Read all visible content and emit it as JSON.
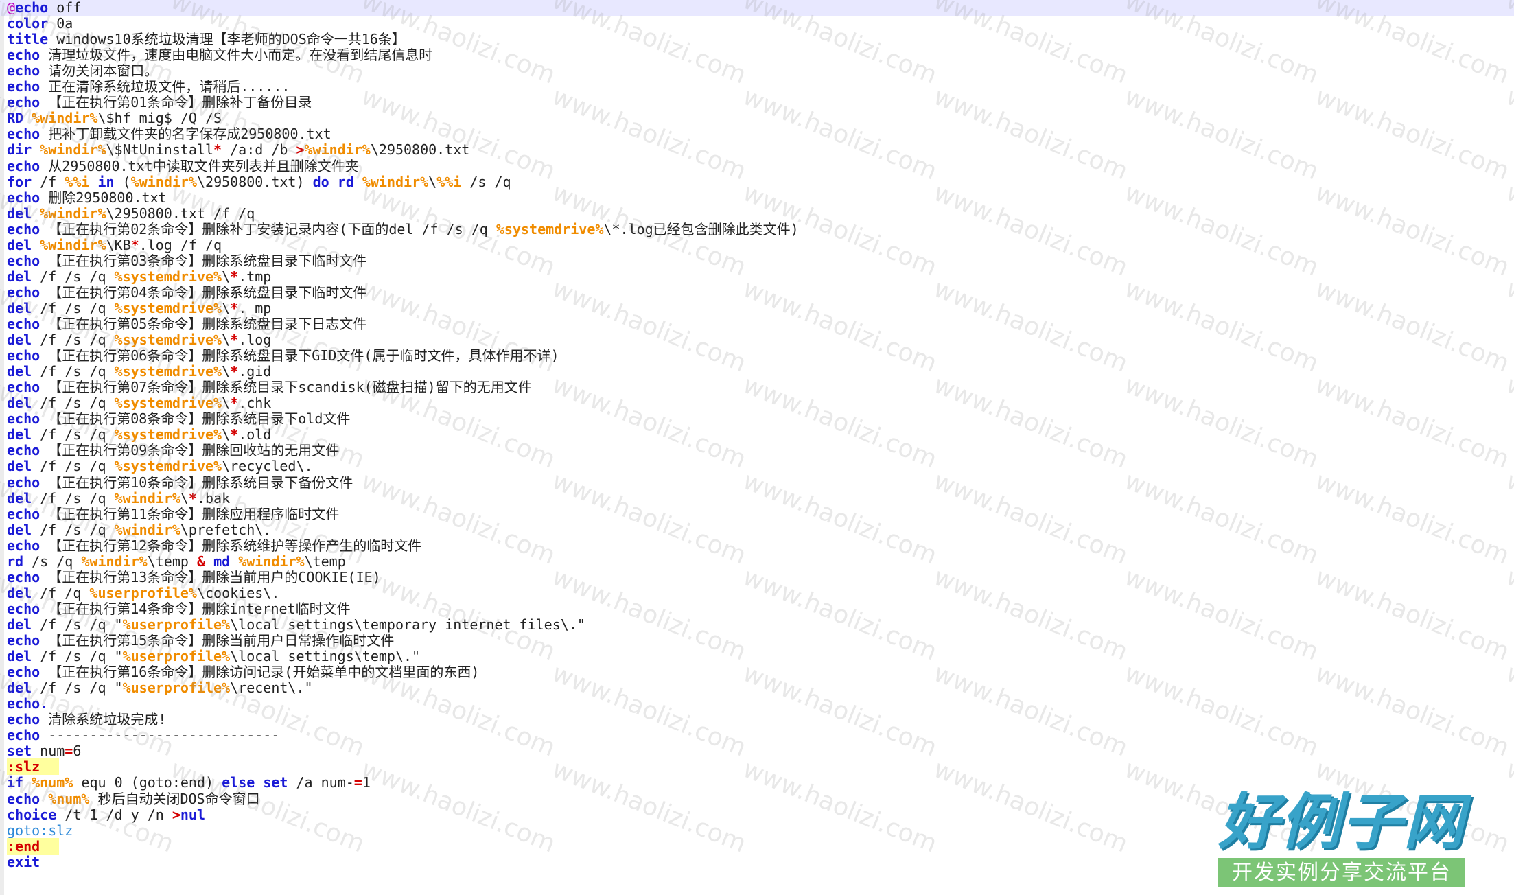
{
  "editor": {
    "lines": [
      [
        [
          "at",
          "@"
        ],
        [
          "kw",
          "echo"
        ],
        [
          "tx",
          " off"
        ]
      ],
      [
        [
          "kw",
          "color"
        ],
        [
          "tx",
          " 0a"
        ]
      ],
      [
        [
          "kw",
          "title"
        ],
        [
          "tx",
          " windows10系统垃圾清理【李老师的DOS命令一共16条】"
        ]
      ],
      [
        [
          "kw",
          "echo"
        ],
        [
          "tx",
          " 清理垃圾文件，速度由电脑文件大小而定。在没看到结尾信息时"
        ]
      ],
      [
        [
          "kw",
          "echo"
        ],
        [
          "tx",
          " 请勿关闭本窗口。"
        ]
      ],
      [
        [
          "kw",
          "echo"
        ],
        [
          "tx",
          " 正在清除系统垃圾文件，请稍后......"
        ]
      ],
      [
        [
          "kw",
          "echo"
        ],
        [
          "tx",
          " 【正在执行第01条命令】删除补丁备份目录"
        ]
      ],
      [
        [
          "kw",
          "RD"
        ],
        [
          "tx",
          " "
        ],
        [
          "var",
          "%windir%"
        ],
        [
          "tx",
          "\\$hf_mig$ /Q /S"
        ]
      ],
      [
        [
          "kw",
          "echo"
        ],
        [
          "tx",
          " 把补丁卸载文件夹的名字保存成2950800.txt"
        ]
      ],
      [
        [
          "kw",
          "dir"
        ],
        [
          "tx",
          " "
        ],
        [
          "var",
          "%windir%"
        ],
        [
          "tx",
          "\\$NtUninstall"
        ],
        [
          "op",
          "*"
        ],
        [
          "tx",
          " /a:d /b "
        ],
        [
          "op",
          ">"
        ],
        [
          "var",
          "%windir%"
        ],
        [
          "tx",
          "\\2950800.txt"
        ]
      ],
      [
        [
          "kw",
          "echo"
        ],
        [
          "tx",
          " 从2950800.txt中读取文件夹列表并且删除文件夹"
        ]
      ],
      [
        [
          "kw",
          "for"
        ],
        [
          "tx",
          " /f "
        ],
        [
          "var",
          "%%i"
        ],
        [
          "tx",
          " "
        ],
        [
          "kw",
          "in"
        ],
        [
          "tx",
          " ("
        ],
        [
          "var",
          "%windir%"
        ],
        [
          "tx",
          "\\2950800.txt) "
        ],
        [
          "kw",
          "do"
        ],
        [
          "tx",
          " "
        ],
        [
          "kw",
          "rd"
        ],
        [
          "tx",
          " "
        ],
        [
          "var",
          "%windir%"
        ],
        [
          "tx",
          "\\"
        ],
        [
          "var",
          "%%i"
        ],
        [
          "tx",
          " /s /q"
        ]
      ],
      [
        [
          "kw",
          "echo"
        ],
        [
          "tx",
          " 删除2950800.txt"
        ]
      ],
      [
        [
          "kw",
          "del"
        ],
        [
          "tx",
          " "
        ],
        [
          "var",
          "%windir%"
        ],
        [
          "tx",
          "\\2950800.txt /f /q"
        ]
      ],
      [
        [
          "kw",
          "echo"
        ],
        [
          "tx",
          " 【正在执行第02条命令】删除补丁安装记录内容(下面的del /f /s /q "
        ],
        [
          "var",
          "%systemdrive%"
        ],
        [
          "tx",
          "\\*.log已经包含删除此类文件)"
        ]
      ],
      [
        [
          "kw",
          "del"
        ],
        [
          "tx",
          " "
        ],
        [
          "var",
          "%windir%"
        ],
        [
          "tx",
          "\\KB"
        ],
        [
          "op",
          "*"
        ],
        [
          "tx",
          ".log /f /q"
        ]
      ],
      [
        [
          "kw",
          "echo"
        ],
        [
          "tx",
          " 【正在执行第03条命令】删除系统盘目录下临时文件"
        ]
      ],
      [
        [
          "kw",
          "del"
        ],
        [
          "tx",
          " /f /s /q "
        ],
        [
          "var",
          "%systemdrive%"
        ],
        [
          "tx",
          "\\"
        ],
        [
          "op",
          "*"
        ],
        [
          "tx",
          ".tmp"
        ]
      ],
      [
        [
          "kw",
          "echo"
        ],
        [
          "tx",
          " 【正在执行第04条命令】删除系统盘目录下临时文件"
        ]
      ],
      [
        [
          "kw",
          "del"
        ],
        [
          "tx",
          " /f /s /q "
        ],
        [
          "var",
          "%systemdrive%"
        ],
        [
          "tx",
          "\\"
        ],
        [
          "op",
          "*"
        ],
        [
          "tx",
          "._mp"
        ]
      ],
      [
        [
          "kw",
          "echo"
        ],
        [
          "tx",
          " 【正在执行第05条命令】删除系统盘目录下日志文件"
        ]
      ],
      [
        [
          "kw",
          "del"
        ],
        [
          "tx",
          " /f /s /q "
        ],
        [
          "var",
          "%systemdrive%"
        ],
        [
          "tx",
          "\\"
        ],
        [
          "op",
          "*"
        ],
        [
          "tx",
          ".log"
        ]
      ],
      [
        [
          "kw",
          "echo"
        ],
        [
          "tx",
          " 【正在执行第06条命令】删除系统盘目录下GID文件(属于临时文件，具体作用不详)"
        ]
      ],
      [
        [
          "kw",
          "del"
        ],
        [
          "tx",
          " /f /s /q "
        ],
        [
          "var",
          "%systemdrive%"
        ],
        [
          "tx",
          "\\"
        ],
        [
          "op",
          "*"
        ],
        [
          "tx",
          ".gid"
        ]
      ],
      [
        [
          "kw",
          "echo"
        ],
        [
          "tx",
          " 【正在执行第07条命令】删除系统目录下scandisk(磁盘扫描)留下的无用文件"
        ]
      ],
      [
        [
          "kw",
          "del"
        ],
        [
          "tx",
          " /f /s /q "
        ],
        [
          "var",
          "%systemdrive%"
        ],
        [
          "tx",
          "\\"
        ],
        [
          "op",
          "*"
        ],
        [
          "tx",
          ".chk"
        ]
      ],
      [
        [
          "kw",
          "echo"
        ],
        [
          "tx",
          " 【正在执行第08条命令】删除系统目录下old文件"
        ]
      ],
      [
        [
          "kw",
          "del"
        ],
        [
          "tx",
          " /f /s /q "
        ],
        [
          "var",
          "%systemdrive%"
        ],
        [
          "tx",
          "\\"
        ],
        [
          "op",
          "*"
        ],
        [
          "tx",
          ".old"
        ]
      ],
      [
        [
          "kw",
          "echo"
        ],
        [
          "tx",
          " 【正在执行第09条命令】删除回收站的无用文件"
        ]
      ],
      [
        [
          "kw",
          "del"
        ],
        [
          "tx",
          " /f /s /q "
        ],
        [
          "var",
          "%systemdrive%"
        ],
        [
          "tx",
          "\\recycled\\."
        ]
      ],
      [
        [
          "kw",
          "echo"
        ],
        [
          "tx",
          " 【正在执行第10条命令】删除系统目录下备份文件"
        ]
      ],
      [
        [
          "kw",
          "del"
        ],
        [
          "tx",
          " /f /s /q "
        ],
        [
          "var",
          "%windir%"
        ],
        [
          "tx",
          "\\"
        ],
        [
          "op",
          "*"
        ],
        [
          "tx",
          ".bak"
        ]
      ],
      [
        [
          "kw",
          "echo"
        ],
        [
          "tx",
          " 【正在执行第11条命令】删除应用程序临时文件"
        ]
      ],
      [
        [
          "kw",
          "del"
        ],
        [
          "tx",
          " /f /s /q "
        ],
        [
          "var",
          "%windir%"
        ],
        [
          "tx",
          "\\prefetch\\."
        ]
      ],
      [
        [
          "kw",
          "echo"
        ],
        [
          "tx",
          " 【正在执行第12条命令】删除系统维护等操作产生的临时文件"
        ]
      ],
      [
        [
          "kw",
          "rd"
        ],
        [
          "tx",
          " /s /q "
        ],
        [
          "var",
          "%windir%"
        ],
        [
          "tx",
          "\\temp "
        ],
        [
          "op",
          "&"
        ],
        [
          "tx",
          " "
        ],
        [
          "kw",
          "md"
        ],
        [
          "tx",
          " "
        ],
        [
          "var",
          "%windir%"
        ],
        [
          "tx",
          "\\temp"
        ]
      ],
      [
        [
          "kw",
          "echo"
        ],
        [
          "tx",
          " 【正在执行第13条命令】删除当前用户的COOKIE(IE)"
        ]
      ],
      [
        [
          "kw",
          "del"
        ],
        [
          "tx",
          " /f /q "
        ],
        [
          "var",
          "%userprofile%"
        ],
        [
          "tx",
          "\\cookies\\."
        ]
      ],
      [
        [
          "kw",
          "echo"
        ],
        [
          "tx",
          " 【正在执行第14条命令】删除internet临时文件"
        ]
      ],
      [
        [
          "kw",
          "del"
        ],
        [
          "tx",
          " /f /s /q \""
        ],
        [
          "var",
          "%userprofile%"
        ],
        [
          "tx",
          "\\local settings\\temporary internet files\\.\""
        ]
      ],
      [
        [
          "kw",
          "echo"
        ],
        [
          "tx",
          " 【正在执行第15条命令】删除当前用户日常操作临时文件"
        ]
      ],
      [
        [
          "kw",
          "del"
        ],
        [
          "tx",
          " /f /s /q \""
        ],
        [
          "var",
          "%userprofile%"
        ],
        [
          "tx",
          "\\local settings\\temp\\.\""
        ]
      ],
      [
        [
          "kw",
          "echo"
        ],
        [
          "tx",
          " 【正在执行第16条命令】删除访问记录(开始菜单中的文档里面的东西)"
        ]
      ],
      [
        [
          "kw",
          "del"
        ],
        [
          "tx",
          " /f /s /q \""
        ],
        [
          "var",
          "%userprofile%"
        ],
        [
          "tx",
          "\\recent\\.\""
        ]
      ],
      [
        [
          "kw",
          "echo."
        ]
      ],
      [
        [
          "kw",
          "echo"
        ],
        [
          "tx",
          " 清除系统垃圾完成!"
        ]
      ],
      [
        [
          "kw",
          "echo"
        ],
        [
          "tx",
          " ----------------------------"
        ]
      ],
      [
        [
          "kw",
          "set"
        ],
        [
          "tx",
          " num"
        ],
        [
          "op",
          "="
        ],
        [
          "tx",
          "6"
        ]
      ],
      [
        [
          "lbl",
          ":slz"
        ]
      ],
      [
        [
          "kw",
          "if"
        ],
        [
          "tx",
          " "
        ],
        [
          "var",
          "%num%"
        ],
        [
          "tx",
          " equ 0 (goto:end) "
        ],
        [
          "kw",
          "else"
        ],
        [
          "tx",
          " "
        ],
        [
          "kw",
          "set"
        ],
        [
          "tx",
          " /a num-"
        ],
        [
          "op",
          "="
        ],
        [
          "tx",
          "1"
        ]
      ],
      [
        [
          "kw",
          "echo"
        ],
        [
          "tx",
          " "
        ],
        [
          "var",
          "%num%"
        ],
        [
          "tx",
          " 秒后自动关闭DOS命令窗口"
        ]
      ],
      [
        [
          "kw",
          "choice"
        ],
        [
          "tx",
          " /t 1 /d y /n "
        ],
        [
          "op",
          ">"
        ],
        [
          "kw",
          "nul"
        ]
      ],
      [
        [
          "gt",
          "goto:slz"
        ]
      ],
      [
        [
          "lbl",
          ":end"
        ]
      ],
      [
        [
          "kw",
          "exit"
        ]
      ]
    ]
  },
  "watermark": {
    "text": "www.haolizi.com"
  },
  "logo": {
    "main": "好例子网",
    "sub": "开发实例分享交流平台",
    "colors": {
      "main": "#38a3c9",
      "bar": "#7cc576"
    }
  }
}
